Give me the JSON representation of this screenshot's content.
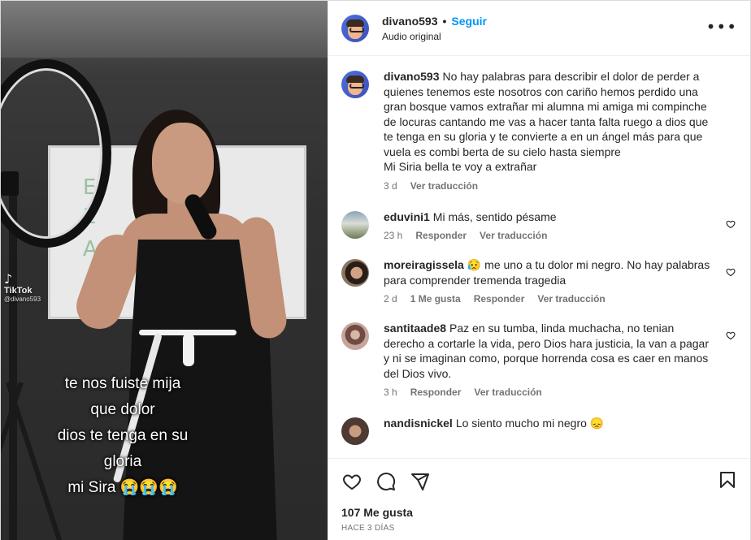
{
  "media": {
    "watermark_logo": "♪",
    "watermark_text": "TikTok",
    "watermark_handle": "@divano593",
    "overlay_lines": [
      "te nos fuiste mija",
      "que dolor",
      "dios te tenga en su",
      "gloria",
      "mi Sira 😭😭😭"
    ]
  },
  "header": {
    "username": "divano593",
    "separator": "•",
    "follow_label": "Seguir",
    "audio_label": "Audio original",
    "more_label": "•••"
  },
  "caption": {
    "username": "divano593",
    "text": "No hay palabras para describir el dolor de perder a quienes tenemos este nosotros con cariño hemos perdido una gran bosque vamos extrañar mi alumna mi amiga mi compinche de locuras cantando me vas a hacer tanta falta ruego a dios que te tenga en su gloria y te convierte a en un ángel más para que vuela es combi berta de su cielo hasta siempre\nMi Siria bella te voy a extrañar",
    "time": "3 d",
    "translate": "Ver traducción"
  },
  "comments": [
    {
      "username": "eduvini1",
      "text": "Mi más, sentido pésame",
      "time": "23 h",
      "reply": "Responder",
      "translate": "Ver traducción",
      "likes": ""
    },
    {
      "username": "moreiragissela",
      "text": "😥 me uno a tu dolor mi negro. No hay palabras para comprender tremenda tragedia",
      "time": "2 d",
      "likes": "1 Me gusta",
      "reply": "Responder",
      "translate": "Ver traducción"
    },
    {
      "username": "santitaade8",
      "text": "Paz en su tumba, linda muchacha, no tenian derecho a cortarle la vida, pero Dios hara justicia, la van a pagar y ni se imaginan como, porque horrenda cosa es caer en manos del Dios vivo.",
      "time": "3 h",
      "reply": "Responder",
      "translate": "Ver traducción",
      "likes": ""
    },
    {
      "username": "nandisnickel",
      "text": "Lo siento mucho mi negro 😞"
    }
  ],
  "footer": {
    "likes": "107 Me gusta",
    "ago": "HACE 3 DÍAS"
  },
  "icons": {
    "like": "heart-outline-icon",
    "comment": "comment-bubble-icon",
    "share": "paper-plane-icon",
    "save": "bookmark-icon",
    "more": "ellipsis-icon"
  },
  "colors": {
    "accent": "#0095f6",
    "text": "#262626",
    "secondary": "#737373",
    "border": "#efefef"
  }
}
